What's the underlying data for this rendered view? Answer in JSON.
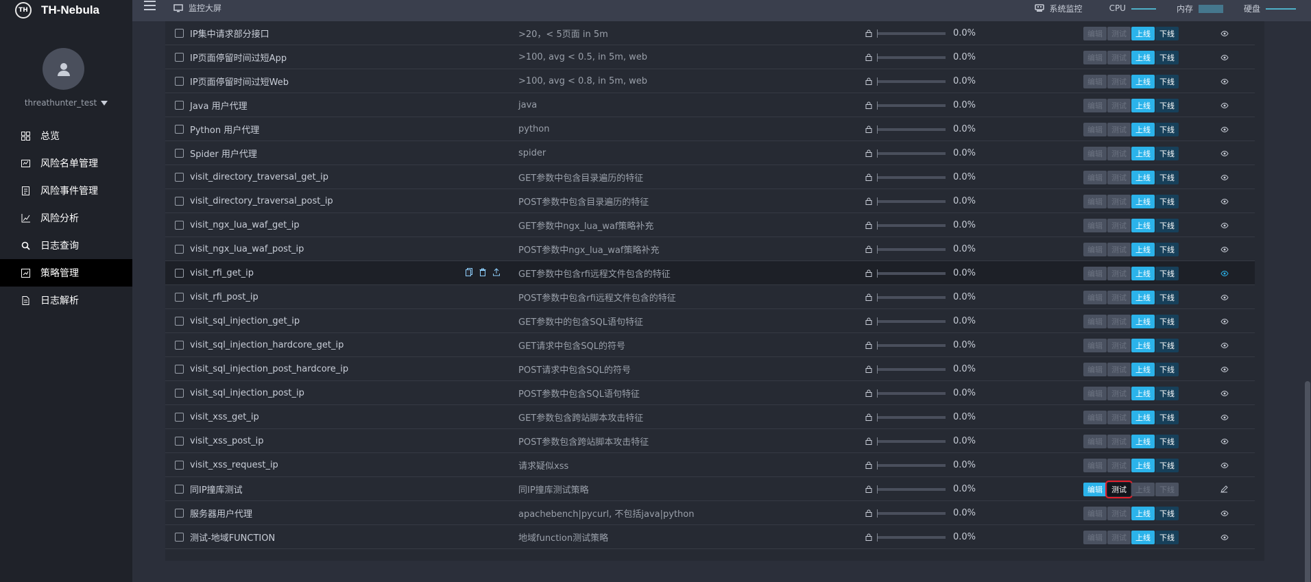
{
  "brand": {
    "logo_text": "TH",
    "name": "TH-Nebula"
  },
  "user": {
    "name": "threathunter_test"
  },
  "nav": [
    {
      "label": "总览",
      "icon": "dashboard-icon",
      "active": false
    },
    {
      "label": "风险名单管理",
      "icon": "list-icon",
      "active": false
    },
    {
      "label": "风险事件管理",
      "icon": "event-icon",
      "active": false
    },
    {
      "label": "风险分析",
      "icon": "chart-icon",
      "active": false
    },
    {
      "label": "日志查询",
      "icon": "search-icon",
      "active": false
    },
    {
      "label": "策略管理",
      "icon": "strategy-icon",
      "active": true
    },
    {
      "label": "日志解析",
      "icon": "document-icon",
      "active": false
    }
  ],
  "topbar": {
    "title": "监控大屏",
    "sysmon_label": "系统监控",
    "cpu_label": "CPU",
    "mem_label": "内存",
    "disk_label": "硬盘"
  },
  "buttons": {
    "edit": "编辑",
    "test": "测试",
    "online": "上线",
    "offline": "下线"
  },
  "rows": [
    {
      "name": "IP集中请求部分接口",
      "desc": ">20，< 5页面 in 5m",
      "pct": "0.0%",
      "state": "online"
    },
    {
      "name": "IP页面停留时间过短App",
      "desc": ">100, avg < 0.5, in 5m, web",
      "pct": "0.0%",
      "state": "online"
    },
    {
      "name": "IP页面停留时间过短Web",
      "desc": ">100, avg < 0.8, in 5m, web",
      "pct": "0.0%",
      "state": "online"
    },
    {
      "name": "Java 用户代理",
      "desc": "java",
      "pct": "0.0%",
      "state": "online"
    },
    {
      "name": "Python 用户代理",
      "desc": "python",
      "pct": "0.0%",
      "state": "online"
    },
    {
      "name": "Spider 用户代理",
      "desc": "spider",
      "pct": "0.0%",
      "state": "online"
    },
    {
      "name": "visit_directory_traversal_get_ip",
      "desc": "GET参数中包含目录遍历的特征",
      "pct": "0.0%",
      "state": "online"
    },
    {
      "name": "visit_directory_traversal_post_ip",
      "desc": "POST参数中包含目录遍历的特征",
      "pct": "0.0%",
      "state": "online"
    },
    {
      "name": "visit_ngx_lua_waf_get_ip",
      "desc": "GET参数中ngx_lua_waf策略补充",
      "pct": "0.0%",
      "state": "online"
    },
    {
      "name": "visit_ngx_lua_waf_post_ip",
      "desc": "POST参数中ngx_lua_waf策略补充",
      "pct": "0.0%",
      "state": "online"
    },
    {
      "name": "visit_rfi_get_ip",
      "desc": "GET参数中包含rfi远程文件包含的特征",
      "pct": "0.0%",
      "state": "online",
      "hover": true
    },
    {
      "name": "visit_rfi_post_ip",
      "desc": "POST参数中包含rfi远程文件包含的特征",
      "pct": "0.0%",
      "state": "online"
    },
    {
      "name": "visit_sql_injection_get_ip",
      "desc": "GET参数中的包含SQL语句特征",
      "pct": "0.0%",
      "state": "online"
    },
    {
      "name": "visit_sql_injection_hardcore_get_ip",
      "desc": "GET请求中包含SQL的符号",
      "pct": "0.0%",
      "state": "online"
    },
    {
      "name": "visit_sql_injection_post_hardcore_ip",
      "desc": "POST请求中包含SQL的符号",
      "pct": "0.0%",
      "state": "online"
    },
    {
      "name": "visit_sql_injection_post_ip",
      "desc": "POST参数中包含SQL语句特征",
      "pct": "0.0%",
      "state": "online"
    },
    {
      "name": "visit_xss_get_ip",
      "desc": "GET参数包含跨站脚本攻击特征",
      "pct": "0.0%",
      "state": "online"
    },
    {
      "name": "visit_xss_post_ip",
      "desc": "POST参数包含跨站脚本攻击特征",
      "pct": "0.0%",
      "state": "online"
    },
    {
      "name": "visit_xss_request_ip",
      "desc": "请求疑似xss",
      "pct": "0.0%",
      "state": "online"
    },
    {
      "name": "同IP撞库测试",
      "desc": "同IP撞库测试策略",
      "pct": "0.0%",
      "state": "draft"
    },
    {
      "name": "服务器用户代理",
      "desc": "apachebench|pycurl, 不包括java|python",
      "pct": "0.0%",
      "state": "online"
    },
    {
      "name": "测试-地域FUNCTION",
      "desc": "地域function测试策略",
      "pct": "0.0%",
      "state": "online"
    }
  ]
}
